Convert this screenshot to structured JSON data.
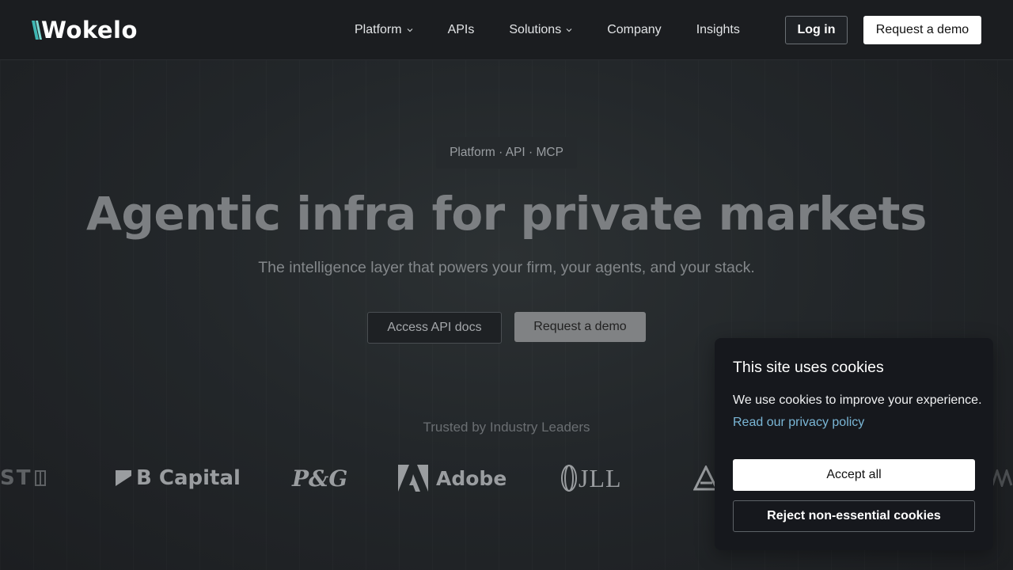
{
  "nav": {
    "logo_text": "Wokelo",
    "items": [
      {
        "label": "Platform",
        "has_dropdown": true
      },
      {
        "label": "APIs",
        "has_dropdown": false
      },
      {
        "label": "Solutions",
        "has_dropdown": true
      },
      {
        "label": "Company",
        "has_dropdown": false
      },
      {
        "label": "Insights",
        "has_dropdown": false
      }
    ],
    "login_label": "Log in",
    "demo_label": "Request a demo"
  },
  "hero": {
    "badge": "Platform · API · MCP",
    "title": "Agentic infra for private markets",
    "subtitle": "The intelligence layer that powers your firm, your agents, and your stack.",
    "api_button": "Access API docs",
    "demo_button": "Request a demo"
  },
  "trusted": {
    "heading": "Trusted by Industry Leaders",
    "logos": [
      {
        "name": "ST",
        "icon": "partial-logo"
      },
      {
        "name": "B Capital",
        "icon": "b-capital-logo"
      },
      {
        "name": "P&G",
        "icon": "pg-logo"
      },
      {
        "name": "Adobe",
        "icon": "adobe-logo"
      },
      {
        "name": "JLL",
        "icon": "jll-logo"
      },
      {
        "name": "",
        "icon": "triangle-logo"
      }
    ]
  },
  "cookie": {
    "title": "This site uses cookies",
    "text": "We use cookies to improve your experience.",
    "link": "Read our privacy policy",
    "accept": "Accept all",
    "reject": "Reject non-essential cookies"
  },
  "colors": {
    "background": "#1c1e21",
    "accent_link": "#7ab6d6",
    "logo_accent": "#3fb6b2"
  }
}
